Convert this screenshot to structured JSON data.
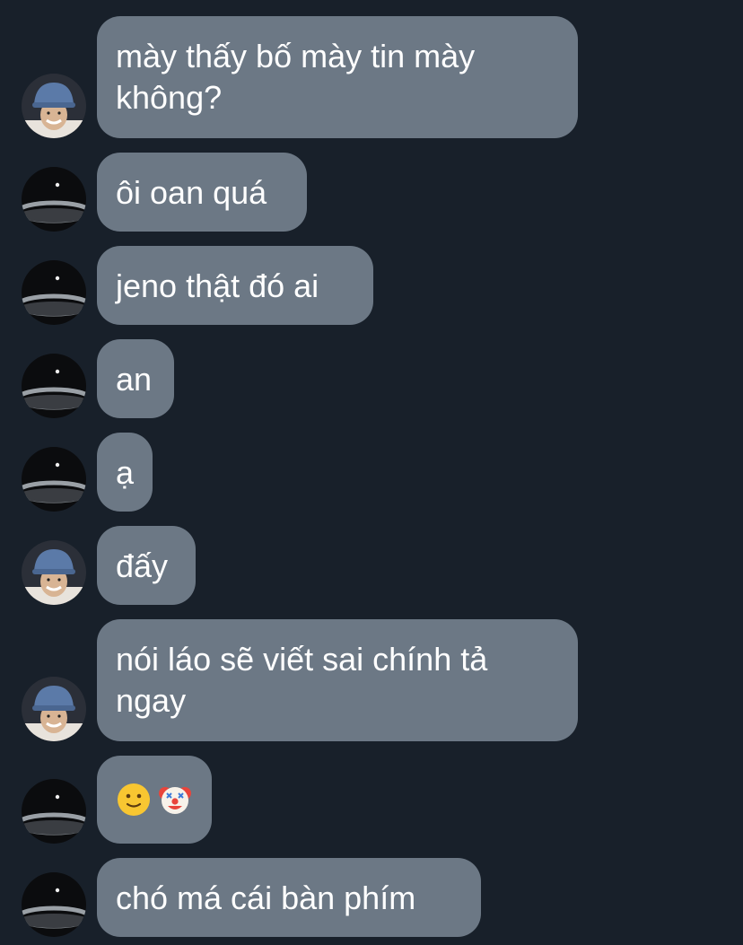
{
  "messages": [
    {
      "id": 1,
      "sender": "hat-person",
      "text": "mày thấy bố mày tin mày không?"
    },
    {
      "id": 2,
      "sender": "dark-avatar",
      "text": "ôi oan quá"
    },
    {
      "id": 3,
      "sender": "dark-avatar",
      "text": "jeno thật đó ai"
    },
    {
      "id": 4,
      "sender": "dark-avatar",
      "text": "an"
    },
    {
      "id": 5,
      "sender": "dark-avatar",
      "text": "ạ"
    },
    {
      "id": 6,
      "sender": "hat-person",
      "text": "đấy"
    },
    {
      "id": 7,
      "sender": "hat-person",
      "text": "nói láo sẽ viết sai chính tả ngay"
    },
    {
      "id": 8,
      "sender": "dark-avatar",
      "emojis": [
        "slightly-smiling-face-icon",
        "clown-face-icon"
      ]
    },
    {
      "id": 9,
      "sender": "dark-avatar",
      "text": "chó má cái bàn phím"
    }
  ],
  "colors": {
    "background": "#18202a",
    "bubble": "#6c7885",
    "text": "#ffffff"
  }
}
